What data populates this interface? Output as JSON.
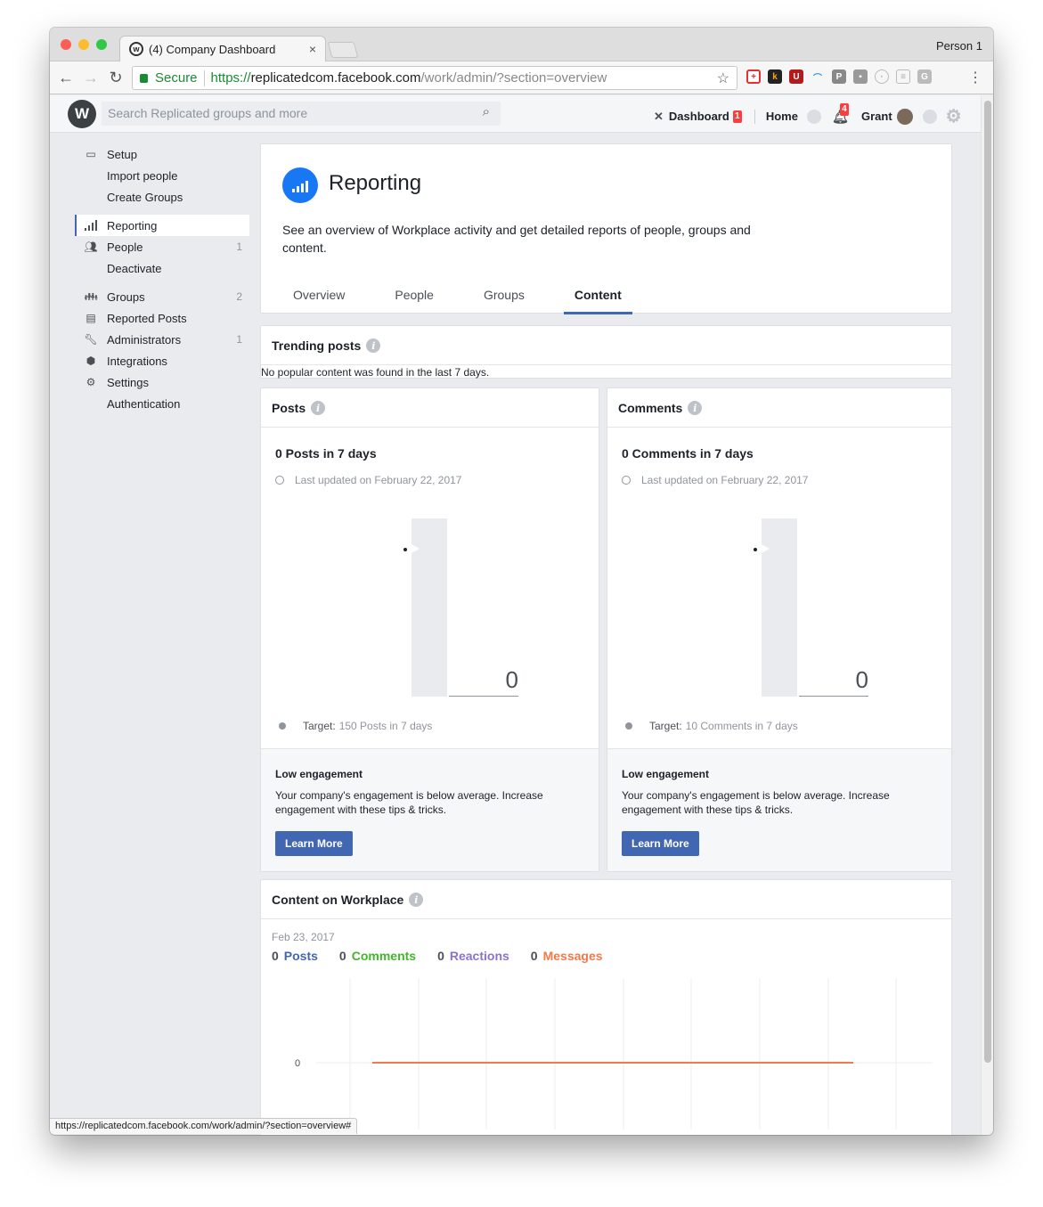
{
  "browser": {
    "tab_title": "(4) Company Dashboard",
    "tab_close": "×",
    "profile": "Person 1",
    "secure_label": "Secure",
    "url_proto": "https://",
    "url_host": "replicatedcom.facebook.com",
    "url_path": "/work/admin/?section=overview",
    "status_url": "https://replicatedcom.facebook.com/work/admin/?section=overview#",
    "traffic_colors": [
      "#fc5f57",
      "#fdbc2e",
      "#33c748"
    ]
  },
  "header": {
    "search_placeholder": "Search Replicated groups and more",
    "dashboard_label": "Dashboard",
    "dashboard_badge": "1",
    "home_label": "Home",
    "notifications_badge": "4",
    "user_name": "Grant"
  },
  "sidebar": {
    "setup": "Setup",
    "import_people": "Import people",
    "create_groups": "Create Groups",
    "reporting": "Reporting",
    "people": "People",
    "people_count": "1",
    "deactivate": "Deactivate",
    "groups": "Groups",
    "groups_count": "2",
    "reported_posts": "Reported Posts",
    "administrators": "Administrators",
    "administrators_count": "1",
    "integrations": "Integrations",
    "settings": "Settings",
    "authentication": "Authentication"
  },
  "report": {
    "title": "Reporting",
    "description": "See an overview of Workplace activity and get detailed reports of people, groups and content.",
    "tabs": [
      "Overview",
      "People",
      "Groups",
      "Content"
    ],
    "active_tab": "Content"
  },
  "trending": {
    "title": "Trending posts",
    "message": "No popular content was found in the last 7 days."
  },
  "posts": {
    "title": "Posts",
    "count": "0 Posts in 7 days",
    "updated": "Last updated on February 22, 2017",
    "value": "0",
    "target_label": "Target:",
    "target_value": "150 Posts in 7 days",
    "low_title": "Low engagement",
    "low_desc": "Your company's engagement is below average. Increase engagement with these tips & tricks.",
    "button": "Learn More"
  },
  "comments": {
    "title": "Comments",
    "count": "0 Comments in 7 days",
    "updated": "Last updated on February 22, 2017",
    "value": "0",
    "target_label": "Target:",
    "target_value": "10 Comments in 7 days",
    "low_title": "Low engagement",
    "low_desc": "Your company's engagement is below average. Increase engagement with these tips & tricks.",
    "button": "Learn More"
  },
  "workplace": {
    "title": "Content on Workplace",
    "date": "Feb 23, 2017",
    "legend": [
      {
        "value": "0",
        "label": "Posts",
        "color": "#4267b2"
      },
      {
        "value": "0",
        "label": "Comments",
        "color": "#42b72a"
      },
      {
        "value": "0",
        "label": "Reactions",
        "color": "#8c72cb"
      },
      {
        "value": "0",
        "label": "Messages",
        "color": "#f2794a"
      }
    ],
    "y_tick": "0",
    "line_color": "#f2794a"
  },
  "info_glyph": "i"
}
